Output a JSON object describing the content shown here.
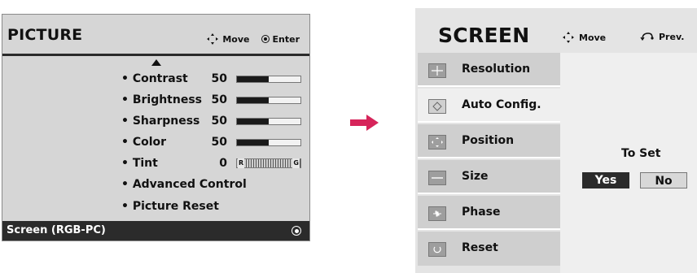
{
  "picture_menu": {
    "title": "PICTURE",
    "hint_move": "Move",
    "hint_enter": "Enter",
    "items": [
      {
        "label": "• Contrast",
        "value": "50",
        "level": 0.5
      },
      {
        "label": "• Brightness",
        "value": "50",
        "level": 0.5
      },
      {
        "label": "• Sharpness",
        "value": "50",
        "level": 0.5
      },
      {
        "label": "• Color",
        "value": "50",
        "level": 0.5
      },
      {
        "label": "• Tint",
        "value": "0",
        "left_mark": "R",
        "right_mark": "G"
      },
      {
        "label": "• Advanced Control"
      },
      {
        "label": "• Picture Reset"
      }
    ],
    "footer": "Screen (RGB-PC)"
  },
  "screen_menu": {
    "title": "SCREEN",
    "hint_move": "Move",
    "hint_prev": "Prev.",
    "items": [
      {
        "label": "Resolution",
        "icon": "plus-icon"
      },
      {
        "label": "Auto Config.",
        "icon": "auto-config-icon"
      },
      {
        "label": "Position",
        "icon": "position-icon"
      },
      {
        "label": "Size",
        "icon": "size-icon"
      },
      {
        "label": "Phase",
        "icon": "phase-icon"
      },
      {
        "label": "Reset",
        "icon": "reset-icon"
      }
    ],
    "selected_index": 1,
    "panel": {
      "prompt": "To Set",
      "yes": "Yes",
      "no": "No"
    }
  }
}
